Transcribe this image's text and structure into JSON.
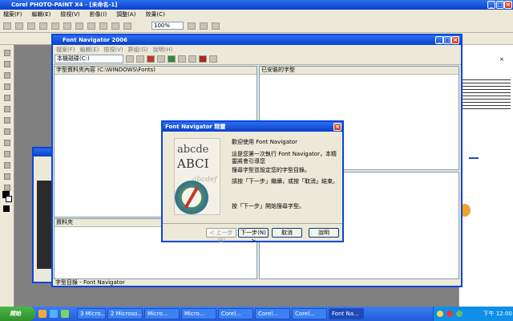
{
  "app": {
    "title": "Corel PHOTO-PAINT X4 - [未命名-1]",
    "menus": [
      "檔案(F)",
      "編輯(E)",
      "檢視(V)",
      "影像(I)",
      "調整(A)",
      "效果(C)"
    ]
  },
  "toolbar": {
    "zoom_value": "100%"
  },
  "navigator": {
    "title": "Font Navigator 2006",
    "menus": [
      "檔案(F)",
      "編輯(E)",
      "檢視(V)",
      "群組(G)",
      "說明(H)"
    ],
    "drive_select": "本機磁碟(C:)",
    "pane_left_header": "字型資料夾內容  (C:\\WINDOWS\\Fonts)",
    "pane_right_header": "已安裝的字型",
    "pane_lower_left_header": "資料夾",
    "status": "字型目錄 - Font Navigator"
  },
  "dialog": {
    "title": "Font Navigator 精靈",
    "heading": "歡迎使用 Font Navigator",
    "line1": "這是您第一次執行 Font Navigator，本精靈將會引導您",
    "line2": "搜尋字型並設定您的字型目錄。",
    "line3": "請按「下一步」繼續，或按「取消」結束。",
    "line4": "按「下一步」開始搜尋字型。",
    "buttons": {
      "back": "< 上一步(B)",
      "next": "下一步(N) >",
      "cancel": "取消",
      "help": "說明"
    },
    "image_text_top": "abcde",
    "image_text_mid": "ABCI",
    "image_text_low": "abcdef"
  },
  "taskbar": {
    "start": "開始",
    "tasks": [
      "3 Micro...",
      "2 Microso...",
      "Micro...",
      "Micro...",
      "Corel...",
      "Corel...",
      "Corel...",
      "Font Na..."
    ],
    "clock": "下午 12:00"
  }
}
